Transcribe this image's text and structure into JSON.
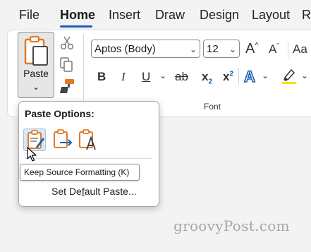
{
  "menu": {
    "items": [
      "File",
      "Home",
      "Insert",
      "Draw",
      "Design",
      "Layout",
      "R"
    ],
    "active": "Home"
  },
  "clipboard": {
    "paste_label": "Paste",
    "cut_icon": "scissors-icon",
    "copy_icon": "copy-icon",
    "format_painter_icon": "format-painter-icon"
  },
  "font": {
    "family_value": "Aptos (Body)",
    "size_value": "12",
    "grow_label": "A",
    "shrink_label": "A",
    "clear_label": "Aa",
    "bold": "B",
    "italic": "I",
    "underline": "U",
    "strike": "ab",
    "subscript": "x",
    "subscript_mark": "2",
    "superscript": "x",
    "superscript_mark": "2",
    "text_effects": "A",
    "group_label": "Font"
  },
  "paste_options": {
    "title": "Paste Options:",
    "options": [
      {
        "name": "Keep Source Formatting",
        "icon": "keep-source-formatting-icon"
      },
      {
        "name": "Merge Formatting",
        "icon": "merge-formatting-icon"
      },
      {
        "name": "Keep Text Only",
        "icon": "keep-text-only-icon"
      }
    ],
    "tooltip": "Keep Source Formatting (K)",
    "set_default_pre": "Set De",
    "set_default_ul": "f",
    "set_default_post": "ault Paste..."
  },
  "colors": {
    "accent": "#1a5fb4",
    "highlight": "#f5e400",
    "clipboard_orange": "#e07b24"
  },
  "watermark": "groovyPost.com"
}
